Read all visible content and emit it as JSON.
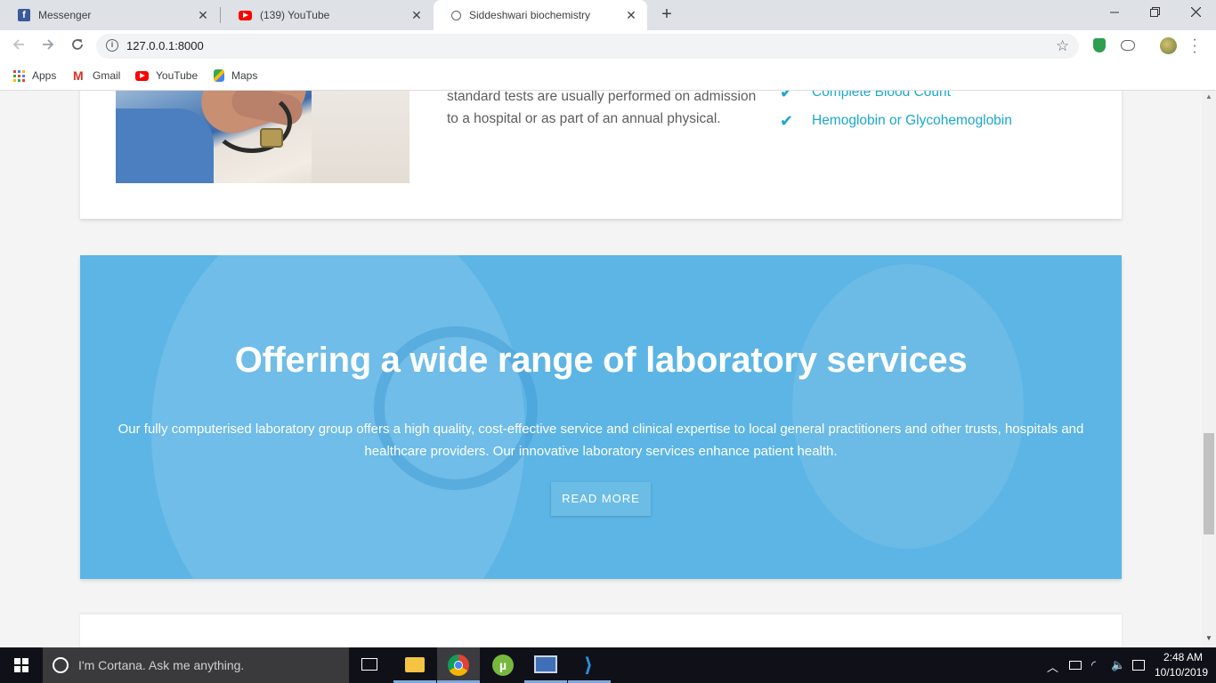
{
  "browser": {
    "tabs": [
      {
        "title": "Messenger",
        "icon": "facebook-icon"
      },
      {
        "title": "(139) YouTube",
        "icon": "youtube-icon"
      },
      {
        "title": "Siddeshwari biochemistry",
        "icon": "globe-icon",
        "active": true
      }
    ],
    "new_tab_glyph": "+",
    "close_glyph": "✕",
    "url": "127.0.0.1:8000",
    "bookmarks": [
      {
        "label": "Apps",
        "icon": "apps-grid-icon"
      },
      {
        "label": "Gmail",
        "icon": "gmail-icon"
      },
      {
        "label": "YouTube",
        "icon": "youtube-icon"
      },
      {
        "label": "Maps",
        "icon": "maps-icon"
      }
    ]
  },
  "page": {
    "top_card": {
      "paragraph_lines": [
        "standard tests are usually performed on admission",
        "to a hospital or as part of an annual physical."
      ],
      "checklist": [
        "Complete Blood Count",
        "Hemoglobin or Glycohemoglobin"
      ]
    },
    "banner": {
      "title": "Offering a wide range of laboratory services",
      "text": "Our fully computerised laboratory group offers a high quality, cost-effective service and clinical expertise to local general practitioners and other trusts, hospitals and healthcare providers. Our innovative laboratory services enhance patient health.",
      "button": "READ MORE"
    }
  },
  "taskbar": {
    "cortana_placeholder": "I'm Cortana. Ask me anything.",
    "time": "2:48 AM",
    "date": "10/10/2019",
    "apps": [
      "task-view",
      "file-explorer",
      "chrome",
      "utorrent",
      "remote-desktop",
      "vscode"
    ]
  },
  "colors": {
    "accent": "#1ba7cf",
    "banner": "#6bbde6",
    "taskbar": "#101018"
  }
}
